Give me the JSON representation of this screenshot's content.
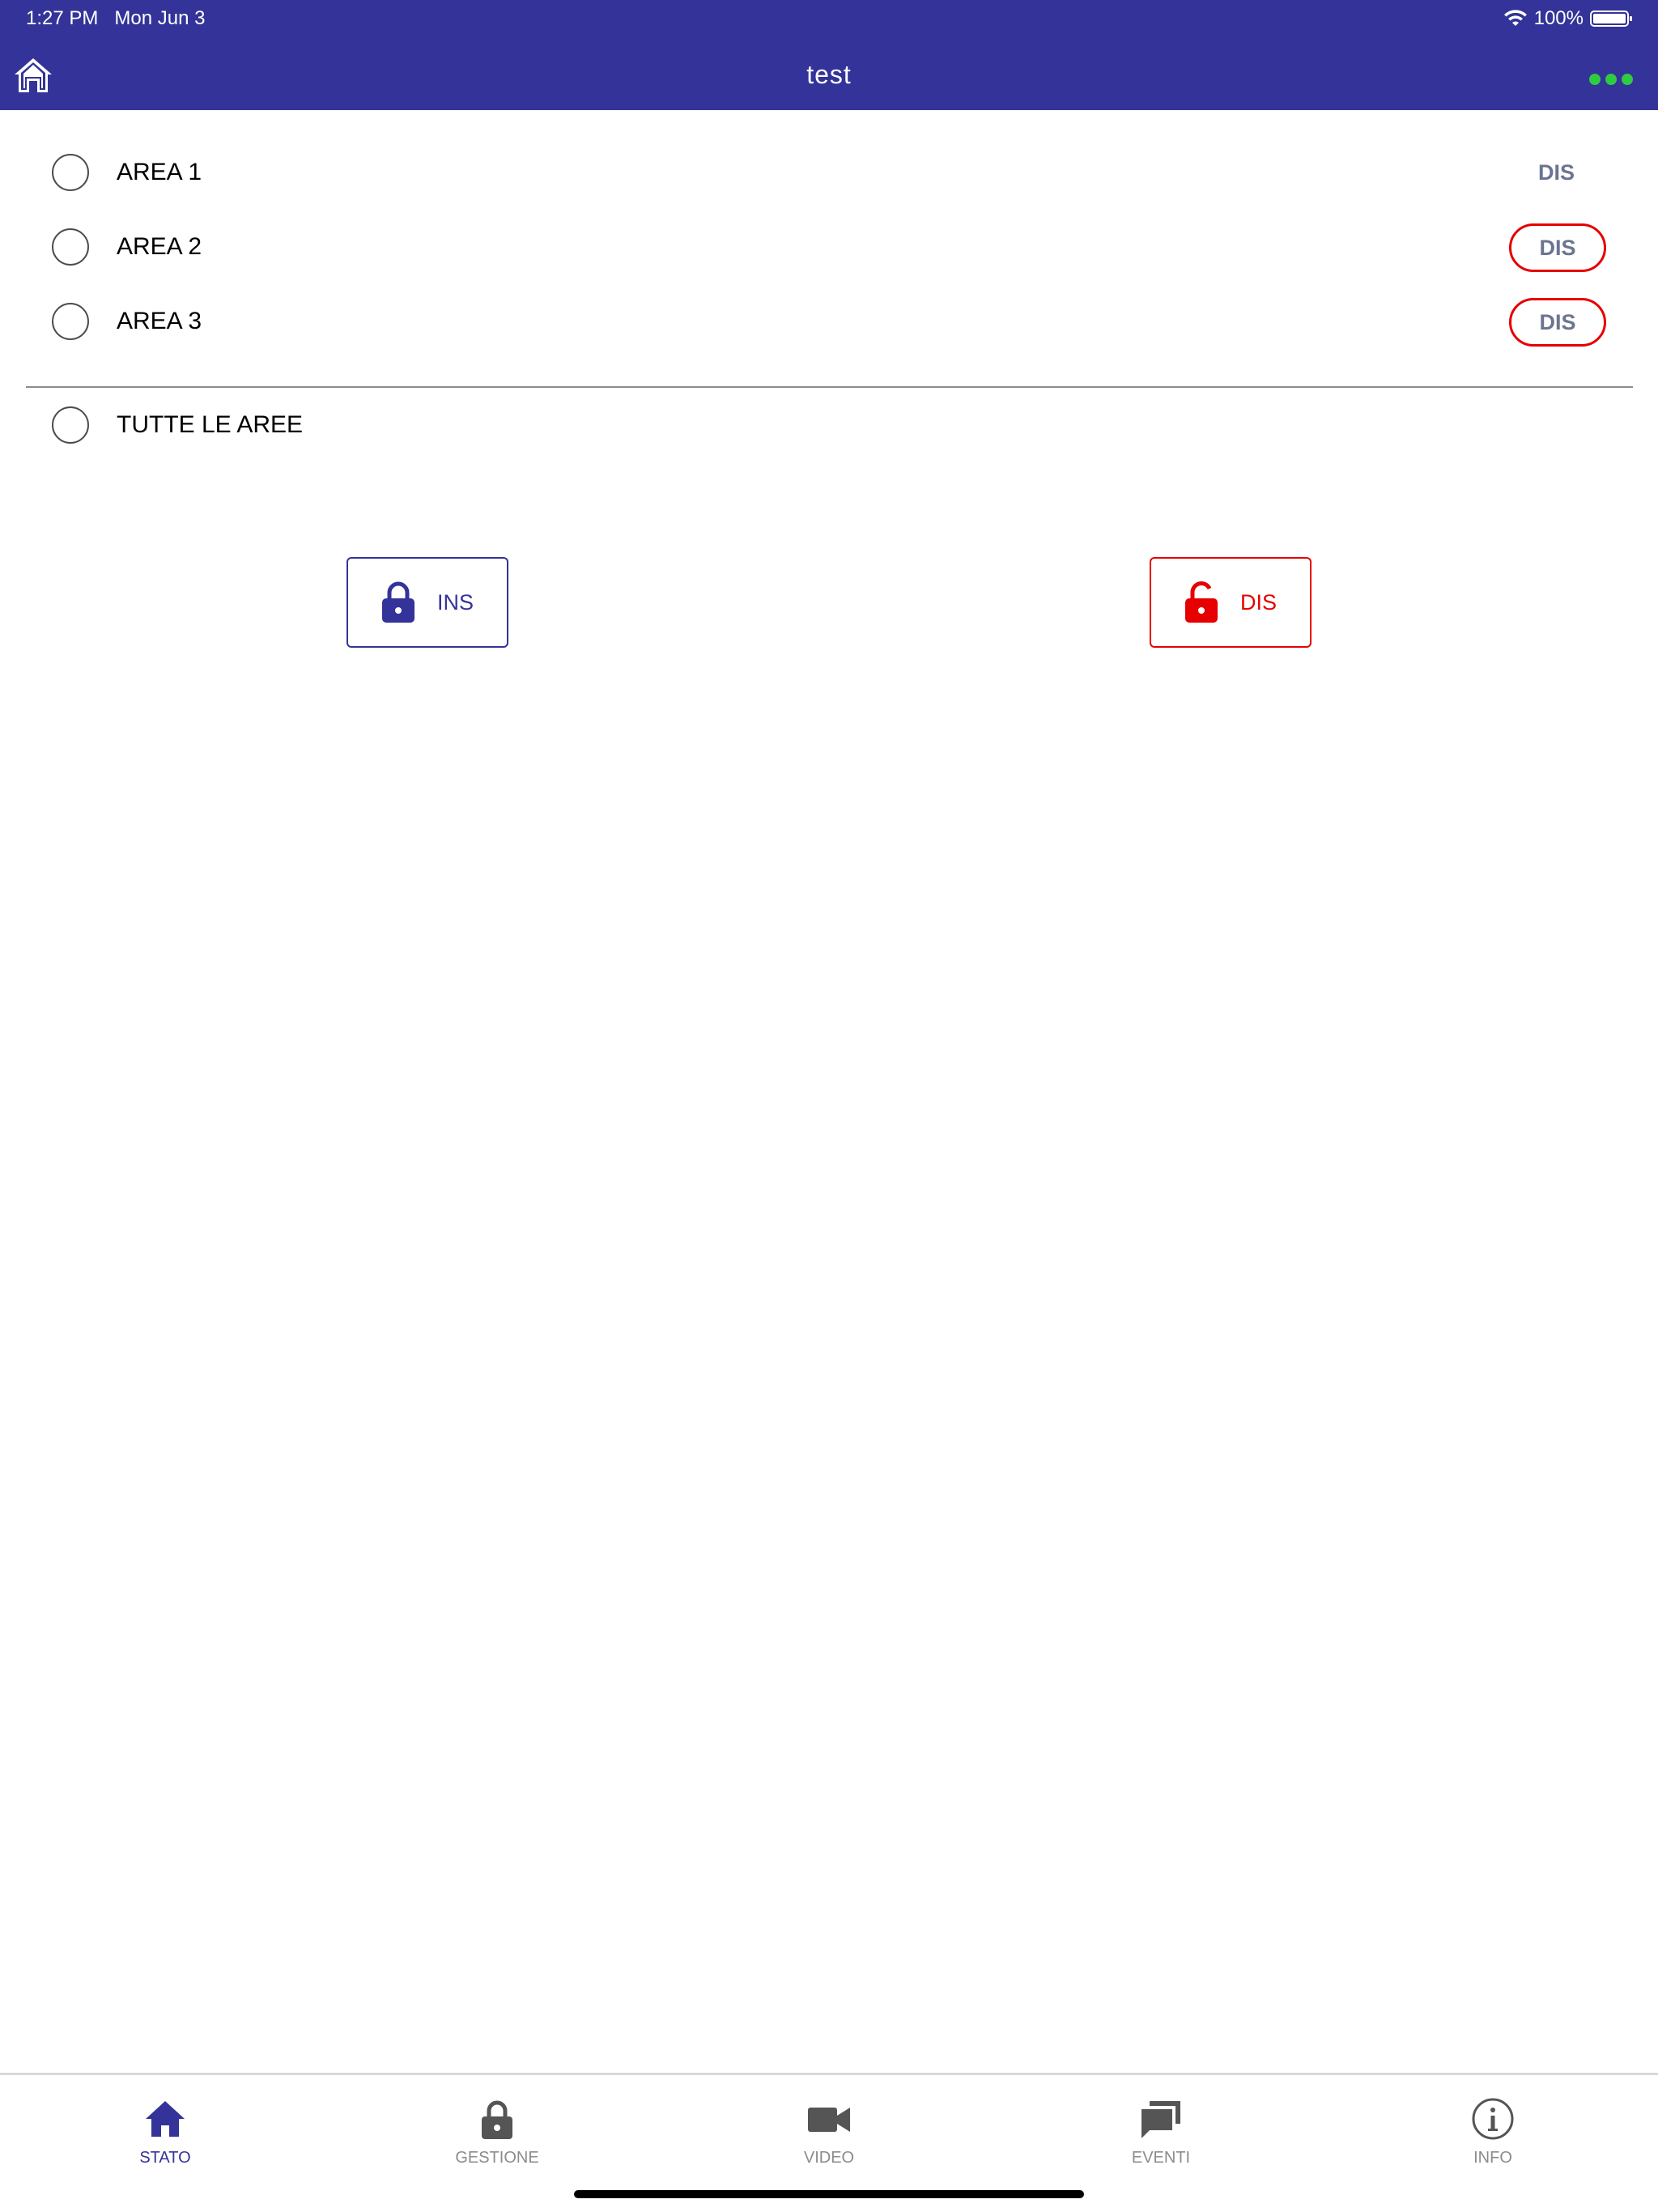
{
  "status_bar": {
    "time": "1:27 PM",
    "date": "Mon Jun 3",
    "battery": "100%"
  },
  "nav": {
    "title": "test"
  },
  "areas": [
    {
      "label": "AREA 1",
      "status": "DIS",
      "style": "plain"
    },
    {
      "label": "AREA 2",
      "status": "DIS",
      "style": "pill"
    },
    {
      "label": "AREA 3",
      "status": "DIS",
      "style": "pill"
    }
  ],
  "all_areas": {
    "label": "TUTTE LE AREE"
  },
  "actions": {
    "ins_label": "INS",
    "dis_label": "DIS"
  },
  "tabs": [
    {
      "label": "STATO",
      "icon": "home-icon",
      "active": true
    },
    {
      "label": "GESTIONE",
      "icon": "lock-icon",
      "active": false
    },
    {
      "label": "VIDEO",
      "icon": "video-camera-icon",
      "active": false
    },
    {
      "label": "EVENTI",
      "icon": "chat-bubbles-icon",
      "active": false
    },
    {
      "label": "INFO",
      "icon": "info-icon",
      "active": false
    }
  ],
  "colors": {
    "brand": "#333399",
    "danger": "#e60000",
    "status_green": "#2ecc40",
    "muted": "#8c8c8c",
    "dis_text": "#6b7590"
  }
}
